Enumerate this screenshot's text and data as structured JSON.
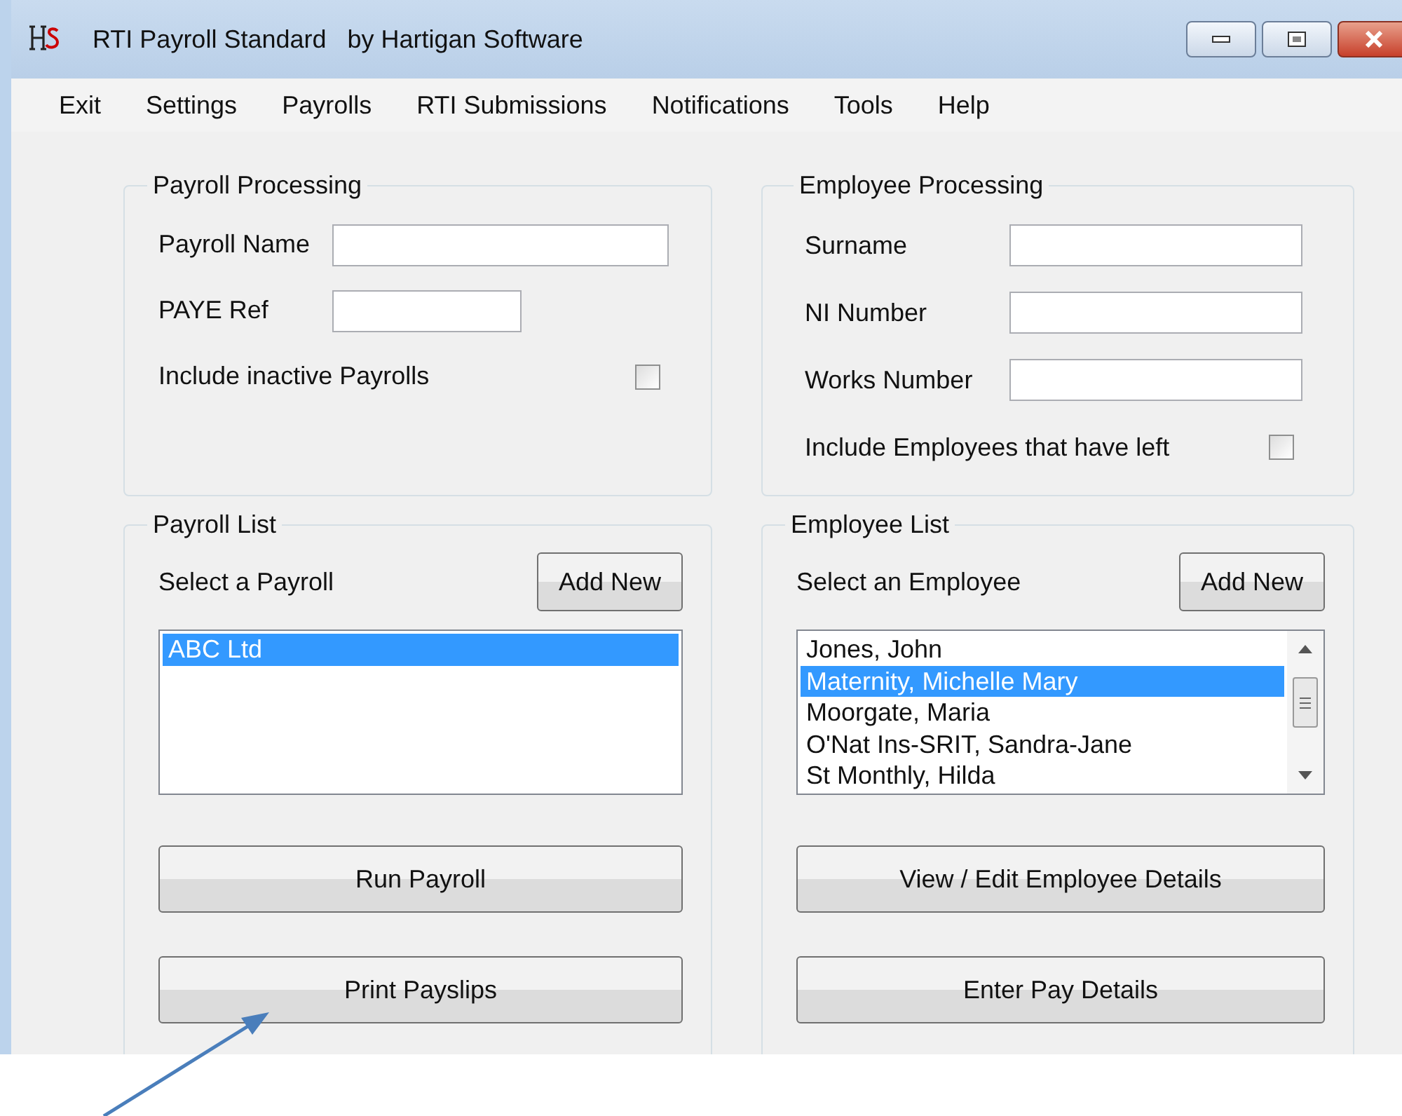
{
  "window": {
    "title": "RTI Payroll Standard   by Hartigan Software"
  },
  "menu": [
    "Exit",
    "Settings",
    "Payrolls",
    "RTI Submissions",
    "Notifications",
    "Tools",
    "Help"
  ],
  "payroll_processing": {
    "title": "Payroll Processing",
    "fields": [
      {
        "label": "Payroll Name"
      },
      {
        "label": "PAYE Ref"
      }
    ],
    "checkbox": {
      "label": "Include inactive Payrolls",
      "checked": false
    }
  },
  "employee_processing": {
    "title": "Employee Processing",
    "fields": [
      {
        "label": "Surname"
      },
      {
        "label": "NI Number"
      },
      {
        "label": "Works Number"
      }
    ],
    "checkbox": {
      "label": "Include Employees that have left",
      "checked": false
    }
  },
  "payroll_list": {
    "title": "Payroll List",
    "prompt": "Select a Payroll",
    "add_button": "Add New",
    "items": [
      {
        "label": "ABC Ltd",
        "selected": true
      }
    ],
    "buttons": [
      "Run Payroll",
      "Print Payslips"
    ]
  },
  "employee_list": {
    "title": "Employee List",
    "prompt": "Select an Employee",
    "add_button": "Add New",
    "items": [
      {
        "label": "Jones, John",
        "selected": false
      },
      {
        "label": "Maternity, Michelle Mary",
        "selected": true
      },
      {
        "label": "Moorgate, Maria",
        "selected": false
      },
      {
        "label": "O'Nat Ins-SRIT, Sandra-Jane",
        "selected": false
      },
      {
        "label": "St Monthly, Hilda",
        "selected": false
      }
    ],
    "buttons": [
      "View / Edit Employee Details",
      "Enter Pay Details"
    ]
  }
}
